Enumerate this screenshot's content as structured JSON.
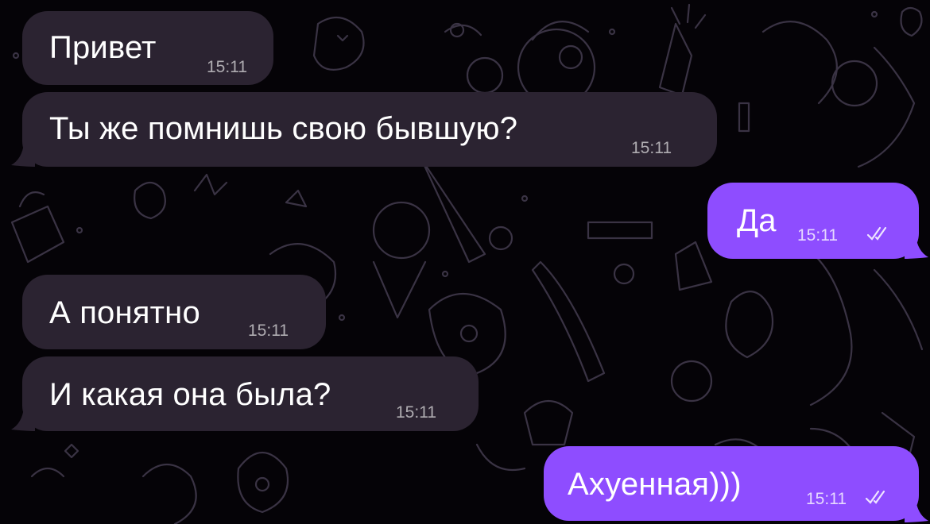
{
  "theme": {
    "incoming_bubble_color": "#2b2331",
    "outgoing_bubble_color": "#8e4dff",
    "background_color": "#050307",
    "doodle_color": "#3a3344"
  },
  "messages": [
    {
      "direction": "incoming",
      "text": "Привет",
      "time": "15:11"
    },
    {
      "direction": "incoming",
      "text": "Ты же помнишь свою бывшую?",
      "time": "15:11"
    },
    {
      "direction": "outgoing",
      "text": "Да",
      "time": "15:11",
      "status": "read-double-check-icon"
    },
    {
      "direction": "incoming",
      "text": "А понятно",
      "time": "15:11"
    },
    {
      "direction": "incoming",
      "text": "И какая она была?",
      "time": "15:11"
    },
    {
      "direction": "outgoing",
      "text": "Ахуенная)))",
      "time": "15:11",
      "status": "read-double-check-icon"
    }
  ]
}
